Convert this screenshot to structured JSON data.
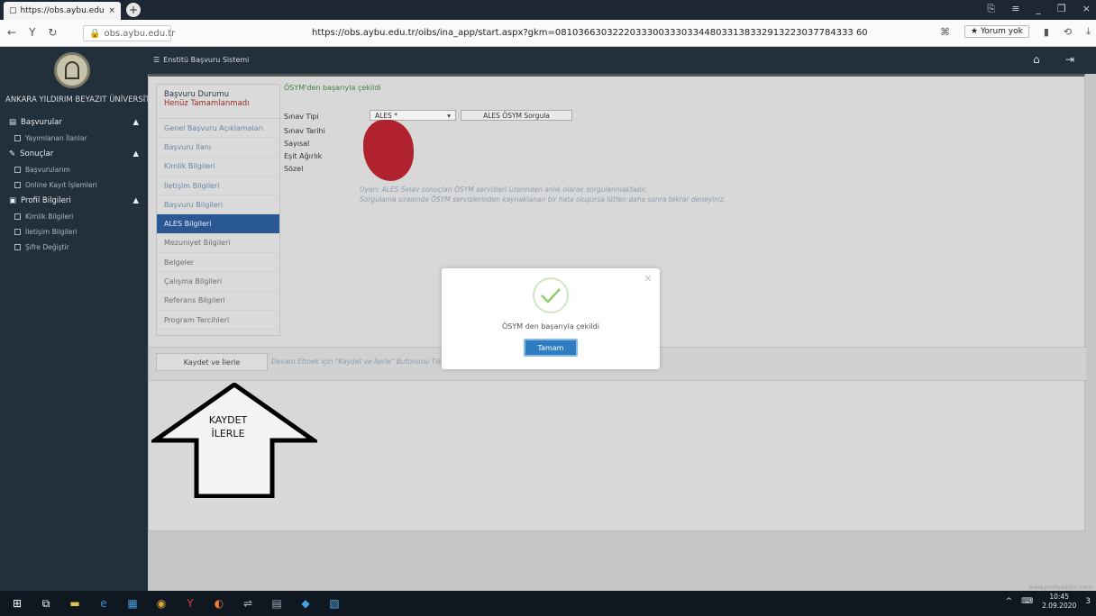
{
  "browser": {
    "tab_title": "https://obs.aybu.edu.tr",
    "tab_close": "×",
    "new_tab": "+",
    "window_controls": [
      "⎘",
      "≡",
      "_",
      "❐",
      "×"
    ],
    "nav": [
      "←",
      "Y",
      "↻"
    ],
    "url_short": "obs.aybu.edu.tr",
    "url_full": "https://obs.aybu.edu.tr/oibs/ina_app/start.aspx?gkm=0810366303222033300333033448033138332913223037784333 60",
    "comment_label": "★ Yorum yok",
    "right_icons": [
      "⌘",
      "▮",
      "⟲",
      "⤓"
    ]
  },
  "sidebar": {
    "university": "ANKARA YILDIRIM BEYAZIT ÜNİVERSİTESİ",
    "groups": [
      {
        "label": "Başvurular",
        "icon": "▤",
        "chev": "▲",
        "items": [
          "Yayımlanan İlanlar"
        ]
      },
      {
        "label": "Sonuçlar",
        "icon": "✎",
        "chev": "▲",
        "items": [
          "Başvurularım",
          "Online Kayıt İşlemleri"
        ]
      },
      {
        "label": "Profil Bilgileri",
        "icon": "▣",
        "chev": "▲",
        "items": [
          "Kimlik Bilgileri",
          "İletişim Bilgileri",
          "Şifre Değiştir"
        ]
      }
    ]
  },
  "header": {
    "menu_icon": "☰",
    "title": "Enstitü Başvuru Sistemi",
    "home_icon": "⌂",
    "logout_icon": "⇥"
  },
  "application": {
    "status_label": "Başvuru Durumu",
    "status_value": "Henüz Tamamlanmadı",
    "tabs": [
      "Genel Başvuru Açıklamaları",
      "Başvuru İlanı",
      "Kimlik Bilgileri",
      "İletişim Bilgileri",
      "Başvuru Bilgileri",
      "ALES Bilgileri",
      "Mezuniyet Bilgileri",
      "Belgeler",
      "Çalışma Bilgileri",
      "Referans Bilgileri",
      "Program Tercihleri"
    ],
    "active_tab": "ALES Bilgileri"
  },
  "form": {
    "success_text": "ÖSYM'den başarıyla çekildi",
    "fields": [
      "Sınav Tipi",
      "Sınav Tarihi",
      "Sayısal",
      "Eşit Ağırlık",
      "Sözel"
    ],
    "exam_type": "ALES *",
    "select_chevron": "▾",
    "query_button": "ALES ÖSYM Sorgula",
    "warning_line1": "Uyarı: ALES Sınav sonuçları ÖSYM servisleri üzerinden anlık olarak sorgulanmaktadır.",
    "warning_line2": "Sorgulama sırasında ÖSYM servislerinden kaynaklanan bir hata oluşursa lütfen daha sonra tekrar deneyiniz."
  },
  "save": {
    "button": "Kaydet ve İlerle",
    "hint": "Devam Etmek için \"Kaydet ve İlerle\" Butonunu Tıklayınız"
  },
  "annotation": {
    "line1": "KAYDET",
    "line2": "İLERLE"
  },
  "modal": {
    "close": "×",
    "message": "ÖSYM den başarıyla çekildi",
    "button": "Tamam",
    "check_color": "#8ccc6b"
  },
  "footer": "www.proliyazilim.com",
  "taskbar": {
    "icons": [
      "⊞",
      "⧉",
      "▬",
      "e",
      "▦",
      "◉",
      "Y",
      "◐",
      "⇌",
      "▤",
      "◆",
      "▧"
    ],
    "tray_icons": [
      "^",
      "⌨"
    ],
    "time": "10:45",
    "date": "2.09.2020",
    "notif": "3"
  }
}
